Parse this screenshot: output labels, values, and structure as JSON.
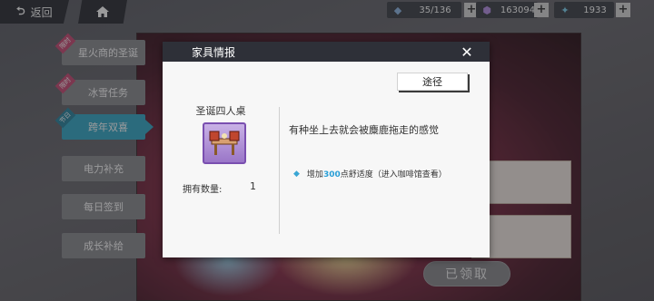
{
  "topbar": {
    "back_label": "返回",
    "resources": [
      {
        "icon": "blue-ticket-icon",
        "value": "35/136"
      },
      {
        "icon": "purple-crystal-icon",
        "value": "163094"
      },
      {
        "icon": "blue-gem-icon",
        "value": "1933"
      }
    ]
  },
  "menu": {
    "items": [
      {
        "label": "星火商的圣诞",
        "tag": "限时",
        "active": false
      },
      {
        "label": "冰雪任务",
        "tag": "限时",
        "active": false
      },
      {
        "label": "跨年双喜",
        "tag": "节日",
        "active": true
      },
      {
        "label": "电力补充",
        "tag": "",
        "active": false
      },
      {
        "label": "每日签到",
        "tag": "",
        "active": false
      },
      {
        "label": "成长补给",
        "tag": "",
        "active": false
      }
    ]
  },
  "background": {
    "claimed_label": "已领取"
  },
  "modal": {
    "title": "家具情报",
    "source_label": "途径",
    "item_name": "圣诞四人桌",
    "owned_label": "拥有数量:",
    "owned_value": "1",
    "description": "有种坐上去就会被麋鹿拖走的感觉",
    "effect_prefix": "增加",
    "effect_value": "300",
    "effect_suffix": "点舒适度（进入咖啡馆查看）"
  },
  "colors": {
    "accent": "#35a9c9",
    "header": "#2e3038",
    "effect_number": "#2a9fd6"
  }
}
